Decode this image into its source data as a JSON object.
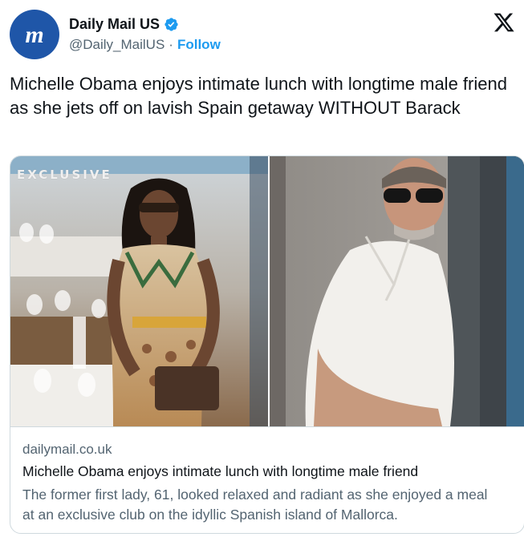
{
  "account": {
    "name": "Daily Mail US",
    "handle": "@Daily_MailUS",
    "separator": "·",
    "follow_label": "Follow",
    "avatar_icon": "daily-mail-logo-icon",
    "verified_icon": "verified-badge-icon",
    "brand_color": "#1f56a8"
  },
  "platform_icon": "x-logo-icon",
  "tweet": {
    "text": "Michelle Obama enjoys intimate lunch with longtime male friend as she jets off on lavish Spain getaway WITHOUT Barack"
  },
  "card": {
    "watermark": "EXCLUSIVE",
    "domain": "dailymail.co.uk",
    "title": "Michelle Obama enjoys intimate lunch with longtime male friend",
    "description": "The former first lady, 61, looked relaxed and radiant as she enjoyed a meal at an exclusive club on the idyllic Spanish island of Mallorca."
  },
  "colors": {
    "link": "#1d9bf0",
    "secondary_text": "#536471",
    "border": "#cfd9de"
  }
}
